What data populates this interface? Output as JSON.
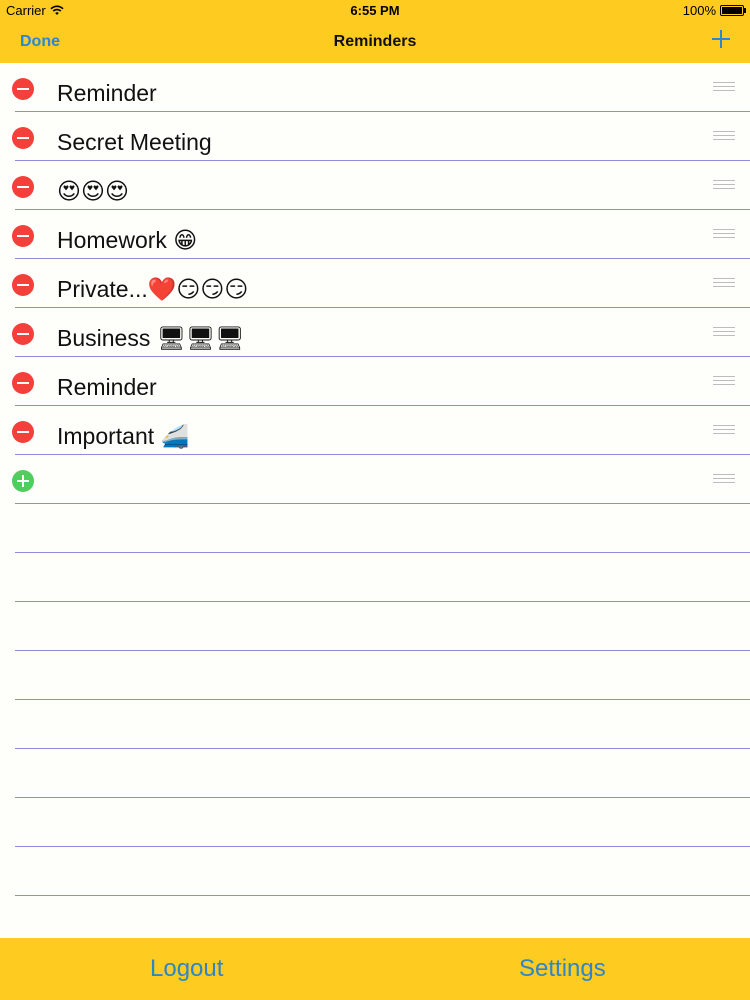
{
  "status_bar": {
    "carrier": "Carrier",
    "time": "6:55 PM",
    "battery": "100%"
  },
  "nav": {
    "done_label": "Done",
    "title": "Reminders",
    "add_icon": "plus-icon"
  },
  "reminders": [
    {
      "text": "Reminder"
    },
    {
      "text": "Secret Meeting"
    },
    {
      "text": "😍😍😍"
    },
    {
      "text": "Homework 😁"
    },
    {
      "text": "Private...❤️😏😏😏"
    },
    {
      "text": "Business 🖥🖥🖥"
    },
    {
      "text": "Reminder"
    },
    {
      "text": "Important 🚄"
    }
  ],
  "new_row": {
    "icon": "add-circle-icon"
  },
  "toolbar": {
    "logout_label": "Logout",
    "settings_label": "Settings"
  },
  "colors": {
    "bar": "#fecb20",
    "accent": "#2c86d5",
    "delete": "#f4403a",
    "insert": "#4fcd5d",
    "rule_line": "#8c8cd8"
  }
}
